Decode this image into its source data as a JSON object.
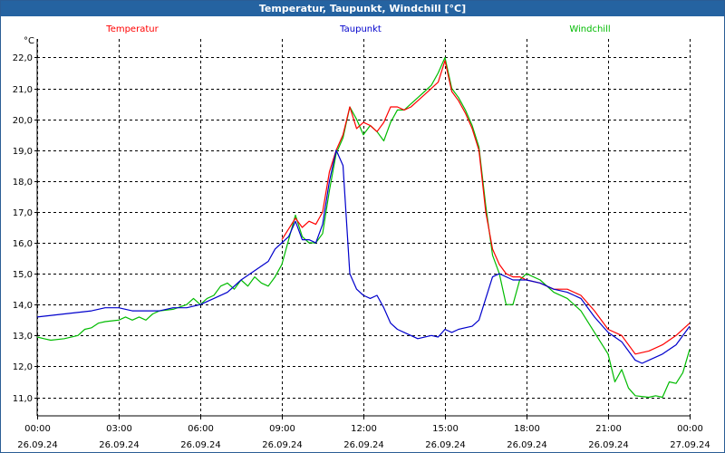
{
  "window": {
    "title": "Temperatur, Taupunkt, Windchill [°C]"
  },
  "colors": {
    "titlebar": "#2563a1",
    "temperature": "#ff0000",
    "dewpoint": "#0000cc",
    "windchill": "#00bb00",
    "grid": "#000000"
  },
  "chart_data": {
    "type": "line",
    "title": "Temperatur, Taupunkt, Windchill [°C]",
    "ylabel": "°C",
    "xlabel": "",
    "ylim": [
      10.4,
      22.6
    ],
    "yticks": [
      "11,0",
      "12,0",
      "13,0",
      "14,0",
      "15,0",
      "16,0",
      "17,0",
      "18,0",
      "19,0",
      "20,0",
      "21,0",
      "22,0"
    ],
    "xlim": [
      0,
      24
    ],
    "xticks": [
      {
        "time": "00:00",
        "date": "26.09.24"
      },
      {
        "time": "03:00",
        "date": "26.09.24"
      },
      {
        "time": "06:00",
        "date": "26.09.24"
      },
      {
        "time": "09:00",
        "date": "26.09.24"
      },
      {
        "time": "12:00",
        "date": "26.09.24"
      },
      {
        "time": "15:00",
        "date": "26.09.24"
      },
      {
        "time": "18:00",
        "date": "26.09.24"
      },
      {
        "time": "21:00",
        "date": "26.09.24"
      },
      {
        "time": "00:00",
        "date": "27.09.24"
      }
    ],
    "grid": true,
    "legend_position": "top",
    "series": [
      {
        "name": "Temperatur",
        "color": "#ff0000",
        "points": [
          [
            9.0,
            16.1
          ],
          [
            9.5,
            16.8
          ],
          [
            9.75,
            16.5
          ],
          [
            10.0,
            16.7
          ],
          [
            10.25,
            16.6
          ],
          [
            10.5,
            17.0
          ],
          [
            10.75,
            18.3
          ],
          [
            11.0,
            19.0
          ],
          [
            11.25,
            19.5
          ],
          [
            11.5,
            20.4
          ],
          [
            11.75,
            19.7
          ],
          [
            12.0,
            19.9
          ],
          [
            12.25,
            19.8
          ],
          [
            12.5,
            19.6
          ],
          [
            12.75,
            19.9
          ],
          [
            13.0,
            20.4
          ],
          [
            13.25,
            20.4
          ],
          [
            13.5,
            20.3
          ],
          [
            13.75,
            20.4
          ],
          [
            14.0,
            20.6
          ],
          [
            14.25,
            20.8
          ],
          [
            14.5,
            21.0
          ],
          [
            14.75,
            21.2
          ],
          [
            15.0,
            21.9
          ],
          [
            15.25,
            20.9
          ],
          [
            15.5,
            20.6
          ],
          [
            15.75,
            20.2
          ],
          [
            16.0,
            19.7
          ],
          [
            16.25,
            19.0
          ],
          [
            16.5,
            17.0
          ],
          [
            16.75,
            15.8
          ],
          [
            17.0,
            15.3
          ],
          [
            17.25,
            15.0
          ],
          [
            17.5,
            14.9
          ],
          [
            17.75,
            14.9
          ],
          [
            18.0,
            14.8
          ],
          [
            18.5,
            14.7
          ],
          [
            19.0,
            14.5
          ],
          [
            19.5,
            14.5
          ],
          [
            20.0,
            14.3
          ],
          [
            20.5,
            13.8
          ],
          [
            21.0,
            13.2
          ],
          [
            21.5,
            13.0
          ],
          [
            22.0,
            12.4
          ],
          [
            22.5,
            12.5
          ],
          [
            23.0,
            12.7
          ],
          [
            23.5,
            13.0
          ],
          [
            24.0,
            13.4
          ]
        ]
      },
      {
        "name": "Taupunkt",
        "color": "#0000cc",
        "points": [
          [
            0.0,
            13.6
          ],
          [
            1.0,
            13.7
          ],
          [
            2.0,
            13.8
          ],
          [
            2.5,
            13.9
          ],
          [
            3.0,
            13.9
          ],
          [
            3.5,
            13.8
          ],
          [
            4.0,
            13.8
          ],
          [
            4.5,
            13.8
          ],
          [
            5.0,
            13.9
          ],
          [
            5.5,
            13.9
          ],
          [
            6.0,
            14.0
          ],
          [
            6.5,
            14.2
          ],
          [
            7.0,
            14.4
          ],
          [
            7.5,
            14.8
          ],
          [
            8.0,
            15.1
          ],
          [
            8.5,
            15.4
          ],
          [
            8.75,
            15.8
          ],
          [
            9.0,
            16.0
          ],
          [
            9.25,
            16.2
          ],
          [
            9.5,
            16.7
          ],
          [
            9.75,
            16.1
          ],
          [
            10.0,
            16.1
          ],
          [
            10.25,
            16.0
          ],
          [
            10.5,
            16.6
          ],
          [
            10.75,
            18.0
          ],
          [
            11.0,
            19.0
          ],
          [
            11.25,
            18.5
          ],
          [
            11.5,
            15.0
          ],
          [
            11.75,
            14.5
          ],
          [
            12.0,
            14.3
          ],
          [
            12.25,
            14.2
          ],
          [
            12.5,
            14.3
          ],
          [
            12.75,
            13.9
          ],
          [
            13.0,
            13.4
          ],
          [
            13.25,
            13.2
          ],
          [
            13.5,
            13.1
          ],
          [
            14.0,
            12.9
          ],
          [
            14.5,
            13.0
          ],
          [
            14.75,
            12.95
          ],
          [
            15.0,
            13.2
          ],
          [
            15.25,
            13.1
          ],
          [
            15.5,
            13.2
          ],
          [
            16.0,
            13.3
          ],
          [
            16.25,
            13.5
          ],
          [
            16.5,
            14.2
          ],
          [
            16.75,
            14.9
          ],
          [
            17.0,
            15.0
          ],
          [
            17.5,
            14.8
          ],
          [
            18.0,
            14.8
          ],
          [
            18.5,
            14.7
          ],
          [
            19.0,
            14.5
          ],
          [
            19.5,
            14.4
          ],
          [
            20.0,
            14.2
          ],
          [
            20.5,
            13.6
          ],
          [
            21.0,
            13.1
          ],
          [
            21.5,
            12.8
          ],
          [
            22.0,
            12.2
          ],
          [
            22.25,
            12.1
          ],
          [
            22.5,
            12.2
          ],
          [
            23.0,
            12.4
          ],
          [
            23.5,
            12.7
          ],
          [
            24.0,
            13.3
          ]
        ]
      },
      {
        "name": "Windchill",
        "color": "#00bb00",
        "points": [
          [
            0.0,
            12.95
          ],
          [
            0.25,
            12.9
          ],
          [
            0.5,
            12.85
          ],
          [
            1.0,
            12.9
          ],
          [
            1.5,
            13.0
          ],
          [
            1.75,
            13.2
          ],
          [
            2.0,
            13.25
          ],
          [
            2.25,
            13.4
          ],
          [
            2.5,
            13.45
          ],
          [
            3.0,
            13.5
          ],
          [
            3.25,
            13.6
          ],
          [
            3.5,
            13.5
          ],
          [
            3.75,
            13.6
          ],
          [
            4.0,
            13.5
          ],
          [
            4.25,
            13.7
          ],
          [
            4.5,
            13.8
          ],
          [
            5.0,
            13.85
          ],
          [
            5.5,
            14.0
          ],
          [
            5.75,
            14.2
          ],
          [
            6.0,
            14.0
          ],
          [
            6.25,
            14.2
          ],
          [
            6.5,
            14.3
          ],
          [
            6.75,
            14.6
          ],
          [
            7.0,
            14.7
          ],
          [
            7.25,
            14.5
          ],
          [
            7.5,
            14.8
          ],
          [
            7.75,
            14.6
          ],
          [
            8.0,
            14.9
          ],
          [
            8.25,
            14.7
          ],
          [
            8.5,
            14.6
          ],
          [
            8.75,
            14.9
          ],
          [
            9.0,
            15.3
          ],
          [
            9.25,
            16.1
          ],
          [
            9.5,
            16.9
          ],
          [
            9.75,
            16.2
          ],
          [
            10.0,
            16.0
          ],
          [
            10.25,
            16.0
          ],
          [
            10.5,
            16.3
          ],
          [
            10.75,
            17.7
          ],
          [
            11.0,
            18.9
          ],
          [
            11.25,
            19.4
          ],
          [
            11.5,
            20.4
          ],
          [
            11.75,
            20.0
          ],
          [
            12.0,
            19.5
          ],
          [
            12.25,
            19.8
          ],
          [
            12.5,
            19.6
          ],
          [
            12.75,
            19.3
          ],
          [
            13.0,
            19.9
          ],
          [
            13.25,
            20.3
          ],
          [
            13.5,
            20.3
          ],
          [
            13.75,
            20.5
          ],
          [
            14.0,
            20.7
          ],
          [
            14.25,
            20.9
          ],
          [
            14.5,
            21.1
          ],
          [
            14.75,
            21.5
          ],
          [
            15.0,
            22.0
          ],
          [
            15.25,
            21.0
          ],
          [
            15.5,
            20.7
          ],
          [
            15.75,
            20.3
          ],
          [
            16.0,
            19.8
          ],
          [
            16.25,
            19.1
          ],
          [
            16.5,
            17.2
          ],
          [
            16.75,
            15.6
          ],
          [
            17.0,
            15.0
          ],
          [
            17.25,
            14.0
          ],
          [
            17.5,
            14.0
          ],
          [
            17.75,
            14.8
          ],
          [
            18.0,
            15.0
          ],
          [
            18.5,
            14.8
          ],
          [
            19.0,
            14.4
          ],
          [
            19.5,
            14.2
          ],
          [
            20.0,
            13.8
          ],
          [
            20.5,
            13.1
          ],
          [
            21.0,
            12.4
          ],
          [
            21.25,
            11.5
          ],
          [
            21.5,
            11.9
          ],
          [
            21.75,
            11.3
          ],
          [
            22.0,
            11.05
          ],
          [
            22.5,
            11.0
          ],
          [
            22.75,
            11.05
          ],
          [
            23.0,
            11.0
          ],
          [
            23.25,
            11.5
          ],
          [
            23.5,
            11.45
          ],
          [
            23.75,
            11.8
          ],
          [
            24.0,
            12.55
          ]
        ]
      }
    ]
  }
}
